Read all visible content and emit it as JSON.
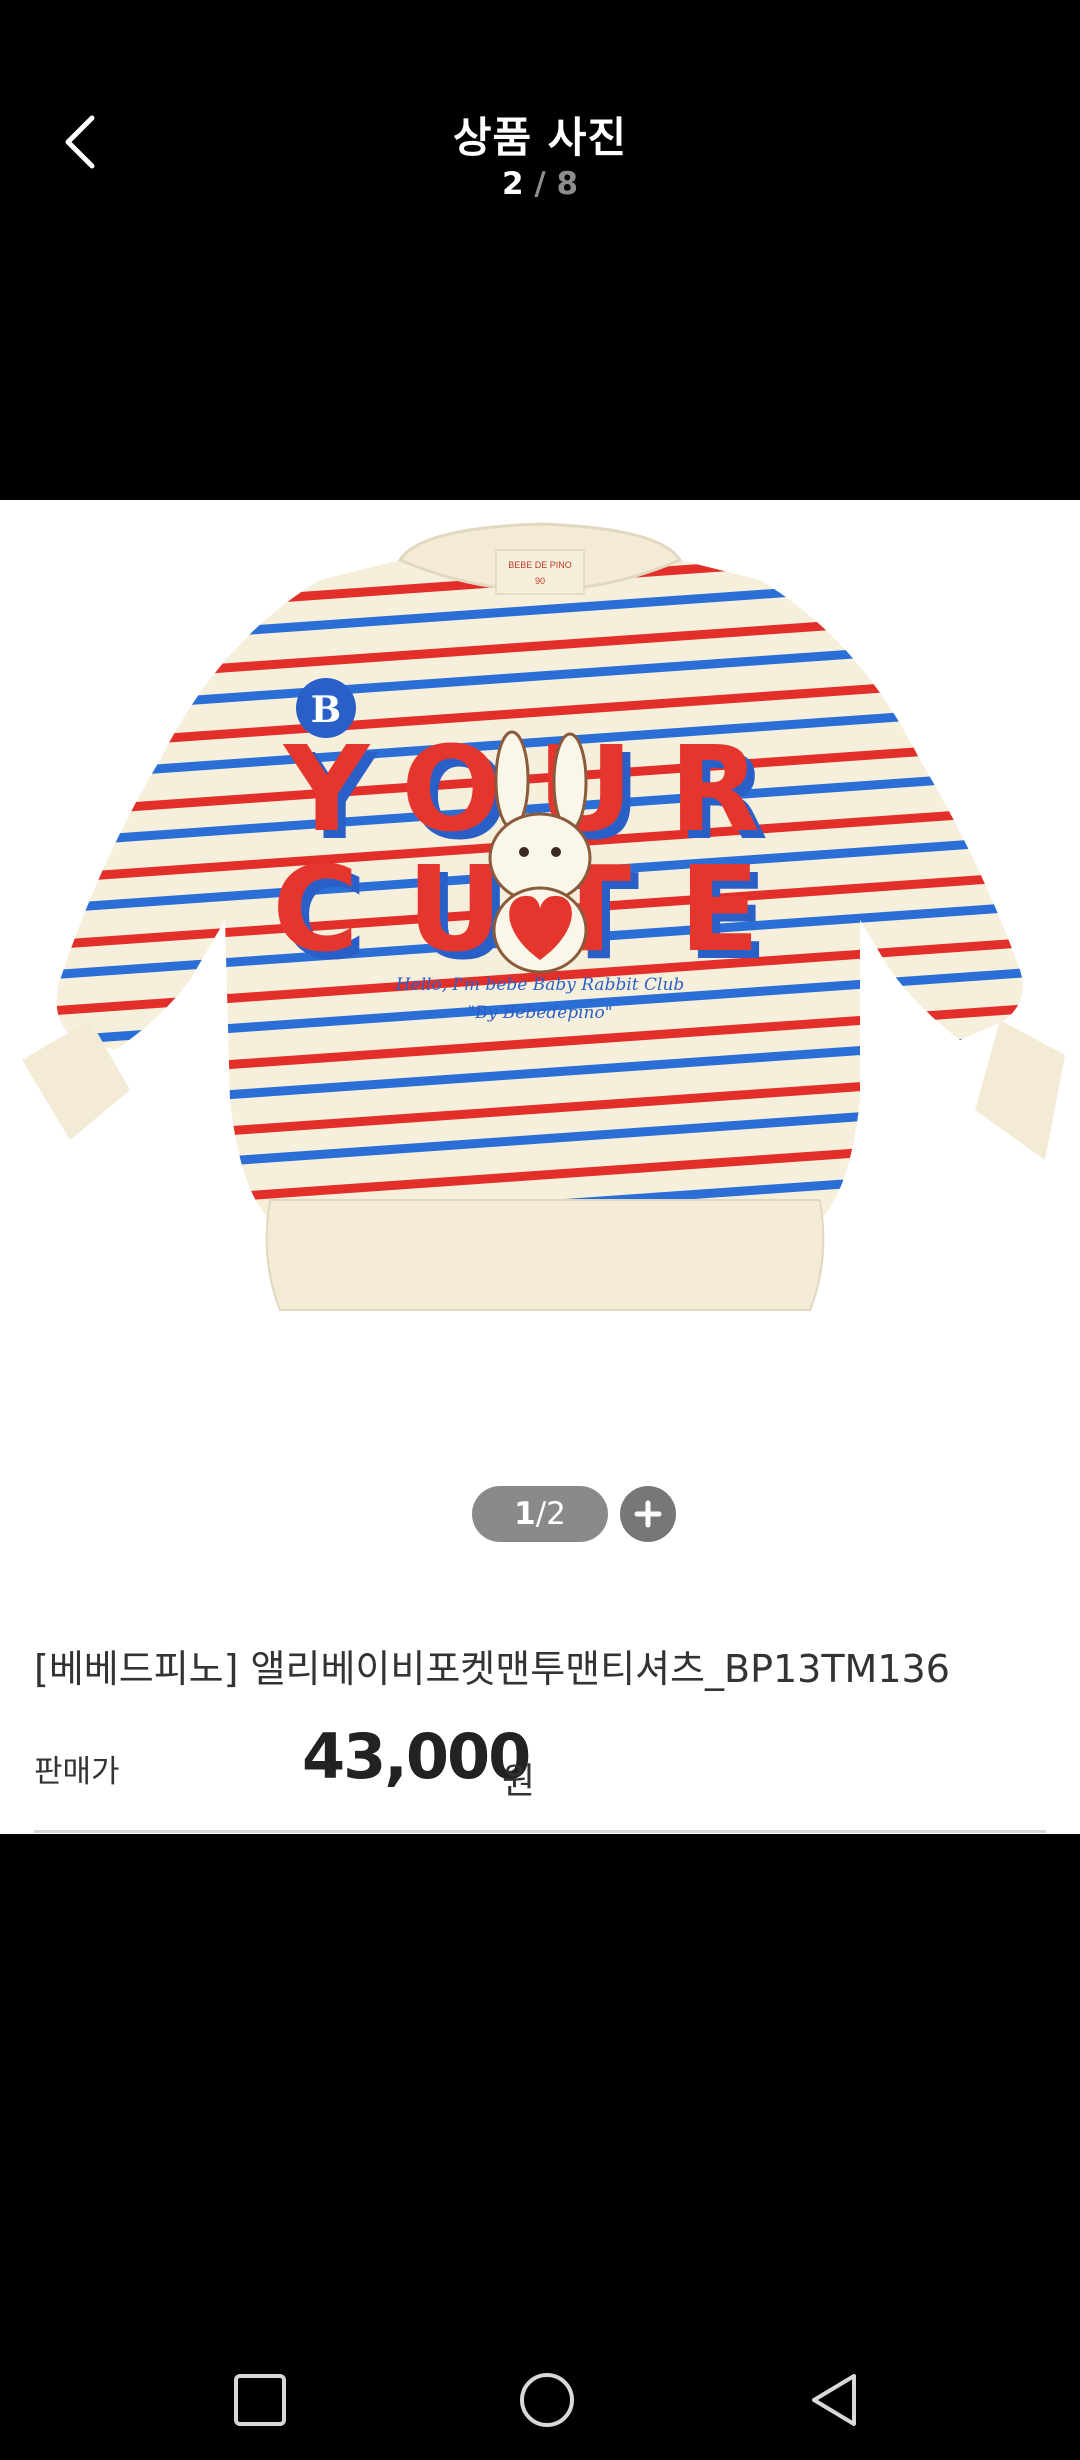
{
  "header": {
    "title": "상품 사진",
    "counter_current": "2",
    "counter_separator": "/",
    "counter_total": "8",
    "back_icon": "chevron-left-icon"
  },
  "image": {
    "logo_text": "B",
    "print_line1": "YOUR",
    "print_line2": "CUTE",
    "script_line1": "Hello, I'm bebe Baby Rabbit Club",
    "script_line2": "\"By Bebedepino\"",
    "tag_line1": "BEBE DE PINO",
    "tag_line2": "90"
  },
  "pager": {
    "current": "1",
    "separator": "/",
    "total": "2",
    "zoom_icon": "plus-icon"
  },
  "product": {
    "name": "[베베드피노] 앨리베이비포켓맨투맨티셔츠_BP13TM136",
    "price_label": "판매가",
    "price_value": "43,000",
    "price_unit": "원"
  },
  "navbar": {
    "recent_icon": "square-icon",
    "home_icon": "circle-icon",
    "back_icon": "triangle-back-icon"
  }
}
